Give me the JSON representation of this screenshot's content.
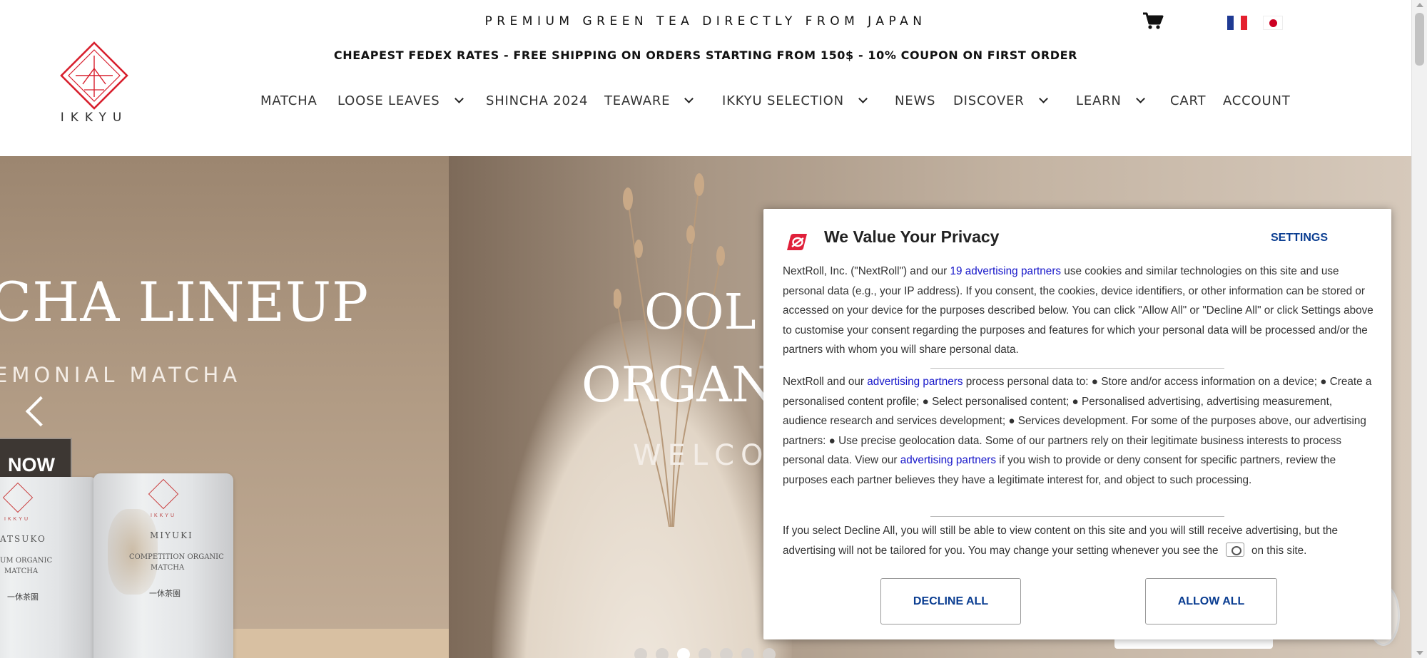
{
  "header": {
    "tagline": "PREMIUM GREEN TEA DIRECTLY FROM JAPAN",
    "promo": "CHEAPEST FEDEX RATES - FREE SHIPPING ON ORDERS STARTING FROM 150$ - 10% COUPON ON FIRST ORDER",
    "logo_text": "IKKYU",
    "icons": {
      "cart": "cart-icon",
      "french": "france-flag-icon",
      "japanese": "japan-flag-icon"
    }
  },
  "nav": {
    "matcha": "MATCHA",
    "loose_leaves": "LOOSE LEAVES",
    "shincha": "SHINCHA 2024",
    "teaware": "TEAWARE",
    "ikkyu_selection": "IKKYU SELECTION",
    "news": "NEWS",
    "discover": "DISCOVER",
    "learn": "LEARN",
    "cart": "CART",
    "account": "ACCOUNT"
  },
  "hero": {
    "slide1_title": "CHA LINEUP",
    "slide1_subtitle": "EMONIAL MATCHA",
    "slide1_button": "NOW",
    "pack1": {
      "name": "ATSUKO",
      "line1": "UM ORGANIC",
      "line2": "MATCHA"
    },
    "pack2": {
      "name": "MIYUKI",
      "line1": "COMPETITION ORGANIC",
      "line2": "MATCHA"
    },
    "pack_brand": "IKKYU",
    "slide2_line1": "OOL",
    "slide2_line2": "ORGAN",
    "slide2_welcome": "WELCO",
    "dots_total": 7,
    "active_dot": 3
  },
  "privacy": {
    "title": "We Value Your Privacy",
    "settings": "SETTINGS",
    "p1_a": "NextRoll, Inc. (\"NextRoll\") and our ",
    "p1_link": "19 advertising partners",
    "p1_b": " use cookies and similar technologies on this site and use personal data (e.g., your IP address). If you consent, the cookies, device identifiers, or other information can be stored or accessed on your device for the purposes described below. You can click \"Allow All\" or \"Decline All\" or click Settings above to customise your consent regarding the purposes and features for which your personal data will be processed and/or the partners with whom you will share personal data.",
    "p2_a": "NextRoll and our ",
    "p2_link1": "advertising partners",
    "p2_b": " process personal data to: ● Store and/or access information on a device; ● Create a personalised content profile; ● Select personalised content; ● Personalised advertising, advertising measurement, audience research and services development; ● Services development. For some of the purposes above, our advertising partners: ● Use precise geolocation data. Some of our partners rely on their legitimate business interests to process personal data. View our ",
    "p2_link2": "advertising partners",
    "p2_c": " if you wish to provide or deny consent for specific partners, review the purposes each partner believes they have a legitimate interest for, and object to such processing.",
    "p3_a": "If you select Decline All, you will still be able to view content on this site and you will still receive advertising, but the advertising will not be tailored for you. You may change your setting whenever you see the ",
    "p3_b": " on this site.",
    "decline": "DECLINE ALL",
    "allow": "ALLOW ALL",
    "colors": {
      "link": "#1515c9",
      "button_text": "#0a3d91",
      "logo": "#e0203a"
    }
  }
}
